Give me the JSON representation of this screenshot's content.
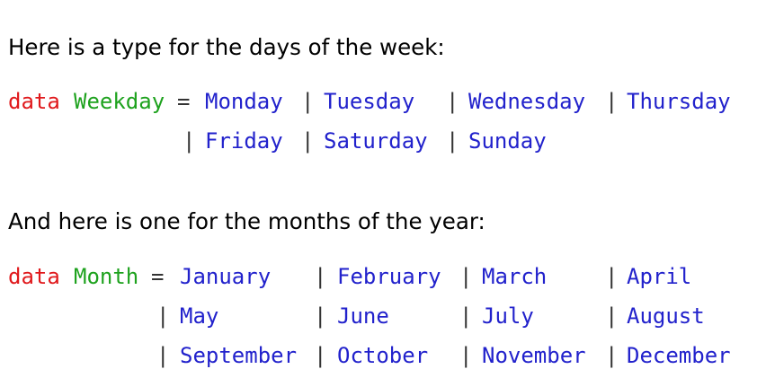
{
  "intro_weekday": "Here is a type for the days of the week:",
  "intro_month": "And here is one for the months of the year:",
  "colors": {
    "keyword": "#e0191c",
    "type_name": "#1ea21e",
    "constructor": "#2222cc",
    "operator": "#333333"
  },
  "weekday_decl": {
    "keyword": "data",
    "type_name": "Weekday",
    "equals": "=",
    "bar": "|",
    "constructors": [
      "Monday",
      "Tuesday",
      "Wednesday",
      "Thursday",
      "Friday",
      "Saturday",
      "Sunday"
    ]
  },
  "month_decl": {
    "keyword": "data",
    "type_name": "Month",
    "equals": "=",
    "bar": "|",
    "constructors": [
      "January",
      "February",
      "March",
      "April",
      "May",
      "June",
      "July",
      "August",
      "September",
      "October",
      "November",
      "December"
    ]
  }
}
